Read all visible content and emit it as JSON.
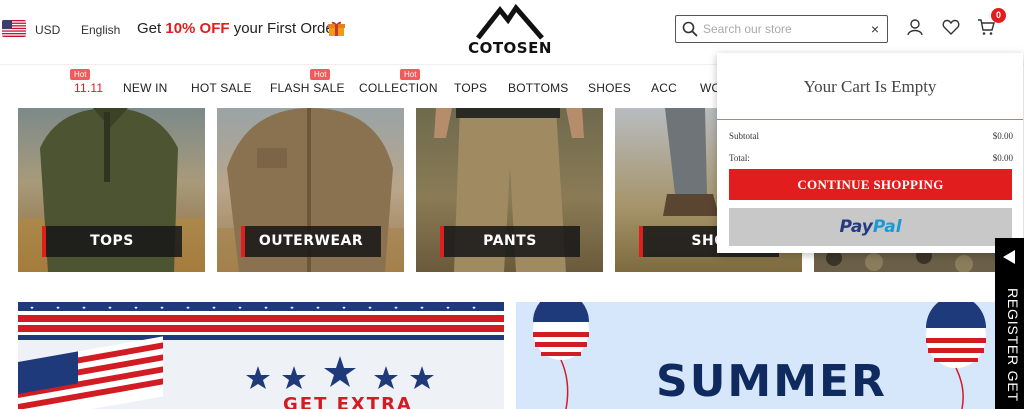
{
  "header": {
    "currency": "USD",
    "language": "English",
    "promo_prefix": "Get ",
    "promo_highlight": "10% OFF",
    "promo_suffix": " your First Order",
    "brand_name": "COTOSEN",
    "search_placeholder": "Search our store",
    "search_clear": "×",
    "cart_count": "0",
    "icons": [
      "us-flag-icon",
      "gift-icon",
      "search-icon",
      "user-icon",
      "heart-icon",
      "cart-icon"
    ]
  },
  "nav": {
    "hot_badge": "Hot",
    "items": [
      {
        "label": "11.11",
        "hot": true,
        "accent": true
      },
      {
        "label": "NEW IN",
        "hot": false
      },
      {
        "label": "HOT SALE",
        "hot": false
      },
      {
        "label": "FLASH SALE",
        "hot": true
      },
      {
        "label": "COLLECTION",
        "hot": true
      },
      {
        "label": "TOPS",
        "hot": false
      },
      {
        "label": "BOTTOMS",
        "hot": false
      },
      {
        "label": "SHOES",
        "hot": false
      },
      {
        "label": "ACC",
        "hot": false
      },
      {
        "label": "WO",
        "hot": false
      }
    ]
  },
  "categories": [
    {
      "label": "TOPS"
    },
    {
      "label": "OUTERWEAR"
    },
    {
      "label": "PANTS"
    },
    {
      "label": "SHO"
    }
  ],
  "banners": {
    "left_text": "GET EXTRA",
    "right_text": "SUMMER"
  },
  "cart": {
    "title": "Your Cart Is Empty",
    "subtotal_label": "Subtotal",
    "subtotal_value": "$0.00",
    "total_label": "Total:",
    "total_value": "$0.00",
    "continue_label": "CONTINUE SHOPPING",
    "paypal_part1": "Pay",
    "paypal_part2": "Pal"
  },
  "side_tab": {
    "label": "REGISTER GET"
  },
  "colors": {
    "accent_red": "#e11d1d",
    "hot_badge": "#f25b5b",
    "paypal_blue_dark": "#253b80",
    "paypal_blue_light": "#179bd7",
    "banner_navy": "#0f2a5e"
  }
}
